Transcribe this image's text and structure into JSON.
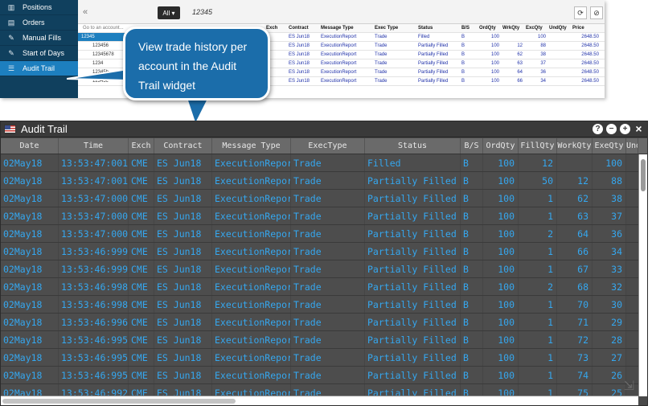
{
  "nav": {
    "items": [
      {
        "label": "Positions",
        "icon": "▥",
        "active": false
      },
      {
        "label": "Orders",
        "icon": "▤",
        "active": false
      },
      {
        "label": "Manual Fills",
        "icon": "✎",
        "active": false
      },
      {
        "label": "Start of Days",
        "icon": "✎",
        "active": false
      },
      {
        "label": "Audit Trail",
        "icon": "☰",
        "active": true
      }
    ]
  },
  "mini": {
    "collapse_icon": "«",
    "filter_label": "All ▾",
    "account_title": "12345",
    "refresh_icon": "⟳",
    "cancel_icon": "⊘",
    "search_placeholder": "Go to an account...",
    "accounts": [
      "12345",
      "123456",
      "12345678",
      "1234",
      "12345b",
      "12345c"
    ],
    "headers": [
      "Exch",
      "Contract",
      "Message Type",
      "Exec Type",
      "Status",
      "B/S",
      "OrdQty",
      "WrkQty",
      "ExcQty",
      "UndQty",
      "Price"
    ],
    "rows": [
      [
        "E",
        "ES Jun18",
        "ExecutionReport",
        "Trade",
        "Filled",
        "B",
        "100",
        "",
        "100",
        "",
        "2648.50"
      ],
      [
        "E",
        "ES Jun18",
        "ExecutionReport",
        "Trade",
        "Partially Filled",
        "B",
        "100",
        "12",
        "88",
        "",
        "2648.50"
      ],
      [
        "E",
        "ES Jun18",
        "ExecutionReport",
        "Trade",
        "Partially Filled",
        "B",
        "100",
        "62",
        "38",
        "",
        "2648.50"
      ],
      [
        "E",
        "ES Jun18",
        "ExecutionReport",
        "Trade",
        "Partially Filled",
        "B",
        "100",
        "63",
        "37",
        "",
        "2648.50"
      ],
      [
        "E",
        "ES Jun18",
        "ExecutionReport",
        "Trade",
        "Partially Filled",
        "B",
        "100",
        "64",
        "36",
        "",
        "2648.50"
      ],
      [
        "E",
        "ES Jun18",
        "ExecutionReport",
        "Trade",
        "Partially Filled",
        "B",
        "100",
        "66",
        "34",
        "",
        "2648.50"
      ]
    ]
  },
  "callout": {
    "text": "View trade history per account in the Audit Trail widget"
  },
  "widget": {
    "title": "Audit Trail",
    "controls": {
      "help": "?",
      "minimize": "−",
      "add": "+",
      "close": "×"
    },
    "resize_icon": "⇲",
    "columns": [
      "Date",
      "Time",
      "Exch",
      "Contract",
      "Message Type",
      "ExecType",
      "Status",
      "B/S",
      "OrdQty",
      "FillQty",
      "WorkQty",
      "ExeQty",
      "Und"
    ],
    "rows": [
      [
        "02May18",
        "13:53:47:001",
        "CME",
        "ES Jun18",
        "ExecutionRepor",
        "Trade",
        "Filled",
        "B",
        "100",
        "12",
        "",
        "100"
      ],
      [
        "02May18",
        "13:53:47:001",
        "CME",
        "ES Jun18",
        "ExecutionRepor",
        "Trade",
        "Partially Filled",
        "B",
        "100",
        "50",
        "12",
        "88"
      ],
      [
        "02May18",
        "13:53:47:000",
        "CME",
        "ES Jun18",
        "ExecutionRepor",
        "Trade",
        "Partially Filled",
        "B",
        "100",
        "1",
        "62",
        "38"
      ],
      [
        "02May18",
        "13:53:47:000",
        "CME",
        "ES Jun18",
        "ExecutionRepor",
        "Trade",
        "Partially Filled",
        "B",
        "100",
        "1",
        "63",
        "37"
      ],
      [
        "02May18",
        "13:53:47:000",
        "CME",
        "ES Jun18",
        "ExecutionRepor",
        "Trade",
        "Partially Filled",
        "B",
        "100",
        "2",
        "64",
        "36"
      ],
      [
        "02May18",
        "13:53:46:999",
        "CME",
        "ES Jun18",
        "ExecutionRepor",
        "Trade",
        "Partially Filled",
        "B",
        "100",
        "1",
        "66",
        "34"
      ],
      [
        "02May18",
        "13:53:46:999",
        "CME",
        "ES Jun18",
        "ExecutionRepor",
        "Trade",
        "Partially Filled",
        "B",
        "100",
        "1",
        "67",
        "33"
      ],
      [
        "02May18",
        "13:53:46:998",
        "CME",
        "ES Jun18",
        "ExecutionRepor",
        "Trade",
        "Partially Filled",
        "B",
        "100",
        "2",
        "68",
        "32"
      ],
      [
        "02May18",
        "13:53:46:998",
        "CME",
        "ES Jun18",
        "ExecutionRepor",
        "Trade",
        "Partially Filled",
        "B",
        "100",
        "1",
        "70",
        "30"
      ],
      [
        "02May18",
        "13:53:46:996",
        "CME",
        "ES Jun18",
        "ExecutionRepor",
        "Trade",
        "Partially Filled",
        "B",
        "100",
        "1",
        "71",
        "29"
      ],
      [
        "02May18",
        "13:53:46:995",
        "CME",
        "ES Jun18",
        "ExecutionRepor",
        "Trade",
        "Partially Filled",
        "B",
        "100",
        "1",
        "72",
        "28"
      ],
      [
        "02May18",
        "13:53:46:995",
        "CME",
        "ES Jun18",
        "ExecutionRepor",
        "Trade",
        "Partially Filled",
        "B",
        "100",
        "1",
        "73",
        "27"
      ],
      [
        "02May18",
        "13:53:46:995",
        "CME",
        "ES Jun18",
        "ExecutionRepor",
        "Trade",
        "Partially Filled",
        "B",
        "100",
        "1",
        "74",
        "26"
      ],
      [
        "02May18",
        "13:53:46:992",
        "CME",
        "ES Jun18",
        "ExecutionRepor",
        "Trade",
        "Partially Filled",
        "B",
        "100",
        "1",
        "75",
        "25"
      ]
    ]
  },
  "colors": {
    "nav_bg": "#10405e",
    "accent": "#1d7fbf",
    "callout_bg": "#1b6daa",
    "cell_text": "#35a7ef",
    "widget_bg": "#4d4d4d"
  }
}
